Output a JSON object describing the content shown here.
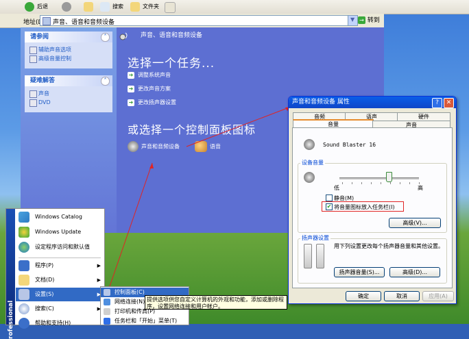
{
  "toolbar": {
    "back_label": "后退",
    "search_label": "搜索",
    "folders_label": "文件夹"
  },
  "address": {
    "label": "地址(D)",
    "value": "声音、语音和音频设备",
    "go_label": "转到"
  },
  "left_panel": {
    "see_also": {
      "title": "请参阅",
      "items": [
        "辅助声音选项",
        "高级音量控制"
      ]
    },
    "troubleshoot": {
      "title": "疑难解答",
      "items": [
        "声音",
        "DVD"
      ]
    }
  },
  "main": {
    "category_title": "声音、语音和音频设备",
    "task_heading": "选择一个任务...",
    "tasks": [
      "调整系统声音",
      "更改声音方案",
      "更改扬声器设置"
    ],
    "or_heading": "或选择一个控制面板图标",
    "icons": [
      "声音和音频设备",
      "语音"
    ]
  },
  "dialog": {
    "title": "声音和音频设备 属性",
    "tabs_top": [
      "音频",
      "语声",
      "硬件"
    ],
    "tabs_bottom": [
      "音量",
      "声音"
    ],
    "device_name": "Sound Blaster 16",
    "device_volume_label": "设备音量",
    "volume_level": 0.62,
    "low_label": "低",
    "high_label": "高",
    "mute_label": "静音(M)",
    "mute_checked": false,
    "taskbar_label": "将音量图标放入任务栏(I)",
    "taskbar_checked": true,
    "advanced_label": "高级(V)...",
    "speaker_group_label": "扬声器设置",
    "speaker_desc": "用下列设置更改每个扬声器音量和其他设置。",
    "speaker_volume_label": "扬声器音量(S)...",
    "speaker_advanced_label": "高级(D)...",
    "ok_label": "确定",
    "cancel_label": "取消",
    "apply_label": "应用(A)"
  },
  "start_menu": {
    "band_text": "rofessional",
    "items": [
      {
        "label": "Windows Catalog",
        "arrow": false
      },
      {
        "label": "Windows Update",
        "arrow": false
      },
      {
        "label": "设定程序访问和默认值",
        "arrow": false
      },
      {
        "label": "程序(P)",
        "arrow": true
      },
      {
        "label": "文档(D)",
        "arrow": true
      },
      {
        "label": "设置(S)",
        "arrow": true
      },
      {
        "label": "搜索(C)",
        "arrow": true
      },
      {
        "label": "帮助和支持(H)",
        "arrow": false
      }
    ]
  },
  "submenu": {
    "items": [
      "控制面板(C)",
      "网络连接(N)",
      "打印机和传真(P)",
      "任务栏和「开始」菜单(T)"
    ]
  },
  "tooltip": {
    "text": "提供选项供您自定义计算机的外观和功能，添加或删除程序，设置网络连接和用户帐户。"
  },
  "colors": {
    "accent_red": "#e02424",
    "selection_blue": "#316ac5"
  }
}
